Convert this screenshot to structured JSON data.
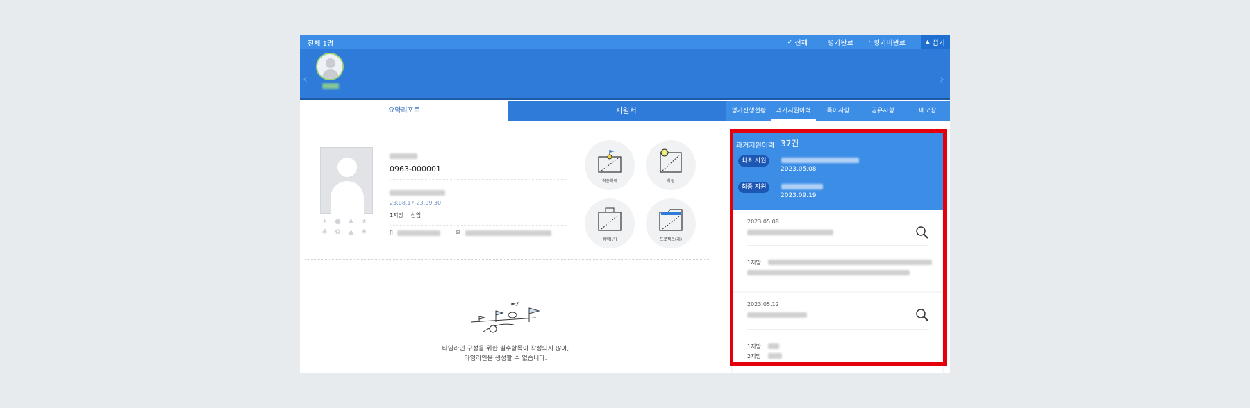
{
  "topbar": {
    "total_label": "전체 1명",
    "filters": [
      {
        "label": "전체",
        "selected": true
      },
      {
        "label": "평가완료",
        "selected": false
      },
      {
        "label": "평가미완료",
        "selected": false
      }
    ],
    "collapse_label": "접기"
  },
  "left_tabs": {
    "summary": "요약리포트",
    "application": "지원서"
  },
  "right_tabs": [
    "평가진행현황",
    "과거지원이력",
    "특이사항",
    "공유사항",
    "메모장"
  ],
  "applicant": {
    "id": "0963-000001",
    "period": "23.08.17-23.09.30",
    "choice_label": "1지망",
    "choice_value": "신입"
  },
  "summary_icons": [
    "최종학력",
    "학점",
    "경력(년)",
    "프로젝트(개)"
  ],
  "timeline": {
    "line1": "타임라인 구성을 위한 필수항목이 작성되지 않아,",
    "line2": "타임라인을 생성할 수 없습니다."
  },
  "history": {
    "title": "과거지원이력",
    "count": "37건",
    "first_label": "최초 지원",
    "first_date": "2023.05.08",
    "last_label": "최종 지원",
    "last_date": "2023.09.19",
    "records": [
      {
        "date": "2023.05.08",
        "choice1": "1지망"
      },
      {
        "date": "2023.05.12",
        "choice1": "1지망",
        "choice2": "2지망"
      }
    ]
  },
  "colors": {
    "primary": "#3b8de6",
    "dark": "#2f7bd9",
    "highlight": "#e3000b"
  }
}
